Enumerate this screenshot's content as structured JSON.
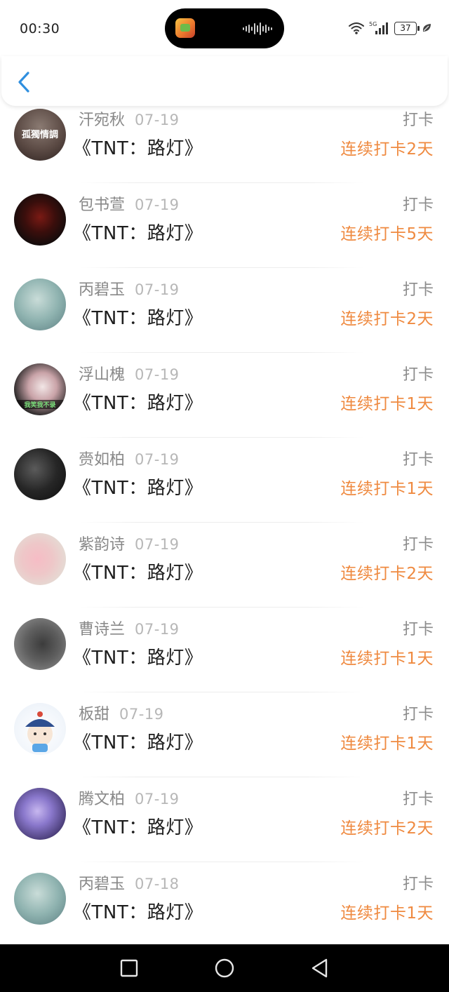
{
  "status_bar": {
    "time": "00:30",
    "network": "5G",
    "battery": "37"
  },
  "header": {
    "back_icon": "chevron-left-icon",
    "accent": "#2f8fdf"
  },
  "list": {
    "title_color": "#1e1e1e",
    "streak_color": "#ef8a40",
    "items": [
      {
        "name": "汗宛秋",
        "date": "07-19",
        "title": "《TNT：路灯》",
        "tag": "打卡",
        "streak": "连续打卡2天",
        "avatar_text": "孤獨情調"
      },
      {
        "name": "包书萱",
        "date": "07-19",
        "title": "《TNT：路灯》",
        "tag": "打卡",
        "streak": "连续打卡5天"
      },
      {
        "name": "丙碧玉",
        "date": "07-19",
        "title": "《TNT：路灯》",
        "tag": "打卡",
        "streak": "连续打卡2天"
      },
      {
        "name": "浮山槐",
        "date": "07-19",
        "title": "《TNT：路灯》",
        "tag": "打卡",
        "streak": "连续打卡1天",
        "avatar_text": "我笑我不录"
      },
      {
        "name": "赍如柏",
        "date": "07-19",
        "title": "《TNT：路灯》",
        "tag": "打卡",
        "streak": "连续打卡1天"
      },
      {
        "name": "紫韵诗",
        "date": "07-19",
        "title": "《TNT：路灯》",
        "tag": "打卡",
        "streak": "连续打卡2天"
      },
      {
        "name": "曹诗兰",
        "date": "07-19",
        "title": "《TNT：路灯》",
        "tag": "打卡",
        "streak": "连续打卡1天"
      },
      {
        "name": "板甜",
        "date": "07-19",
        "title": "《TNT：路灯》",
        "tag": "打卡",
        "streak": "连续打卡1天"
      },
      {
        "name": "腾文柏",
        "date": "07-19",
        "title": "《TNT：路灯》",
        "tag": "打卡",
        "streak": "连续打卡2天"
      },
      {
        "name": "丙碧玉",
        "date": "07-18",
        "title": "《TNT：路灯》",
        "tag": "打卡",
        "streak": "连续打卡1天"
      }
    ]
  },
  "nav_bar": {
    "buttons": [
      "recents-square-icon",
      "home-circle-icon",
      "back-triangle-icon"
    ]
  }
}
